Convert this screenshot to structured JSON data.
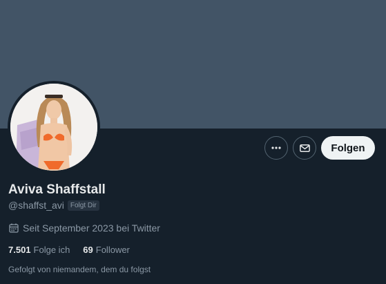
{
  "profile": {
    "display_name": "Aviva Shaffstall",
    "handle": "@shaffst_avi",
    "follows_you_badge": "Folgt Dir",
    "joined_text": "Seit September 2023 bei Twitter",
    "following_count": "7.501",
    "following_label": "Folge ich",
    "followers_count": "69",
    "followers_label": "Follower",
    "followed_by_text": "Gefolgt von niemandem, dem du folgst"
  },
  "actions": {
    "more_icon": "more-horizontal-icon",
    "message_icon": "envelope-icon",
    "follow_label": "Folgen"
  },
  "colors": {
    "background": "#15202b",
    "banner": "#425466",
    "primary_text": "#e7e9ea",
    "secondary_text": "#8b98a5",
    "follow_button": "#eff3f4"
  }
}
